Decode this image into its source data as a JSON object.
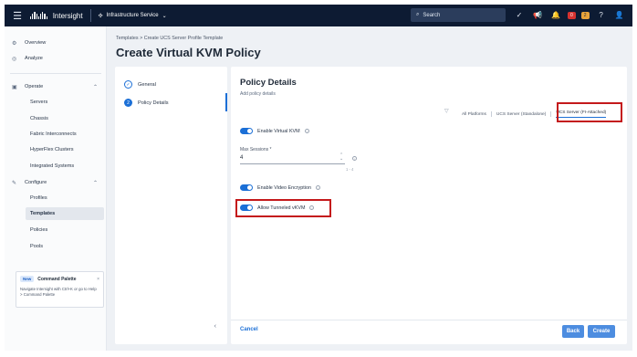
{
  "topbar": {
    "brand": "Intersight",
    "service": "Infrastructure Service",
    "search_placeholder": "Search",
    "badge_red": "0",
    "badge_orange": "2"
  },
  "sidebar": {
    "items": [
      {
        "label": "Overview",
        "icon": "gear-icon"
      },
      {
        "label": "Analyze",
        "icon": "target-icon"
      },
      {
        "label": "Operate",
        "icon": "operate-icon"
      },
      {
        "label": "Servers"
      },
      {
        "label": "Chassis"
      },
      {
        "label": "Fabric Interconnects"
      },
      {
        "label": "HyperFlex Clusters"
      },
      {
        "label": "Integrated Systems"
      },
      {
        "label": "Configure",
        "icon": "wrench-icon"
      },
      {
        "label": "Profiles"
      },
      {
        "label": "Templates"
      },
      {
        "label": "Policies"
      },
      {
        "label": "Pools"
      }
    ],
    "command_palette": {
      "tag": "New",
      "title": "Command Palette",
      "text": "Navigate Intersight with Ctrl+K or go to Help > Command Palette"
    }
  },
  "main": {
    "breadcrumb": "Templates  >  Create UCS Server Profile Template",
    "title": "Create Virtual KVM Policy",
    "steps": [
      {
        "label": "General",
        "marker": "✓"
      },
      {
        "label": "Policy Details",
        "marker": "2"
      }
    ],
    "panel": {
      "title": "Policy Details",
      "subtitle": "Add policy details",
      "platforms": [
        "All Platforms",
        "UCS Server (Standalone)",
        "UCS Server (FI-Attached)"
      ],
      "enable_vkvm": "Enable Virtual KVM",
      "max_sessions_label": "Max Sessions *",
      "max_sessions_value": "4",
      "max_sessions_range": "1 - 4",
      "enable_video_encryption": "Enable Video Encryption",
      "allow_tunneled_vkvm": "Allow Tunneled vKVM"
    },
    "footer": {
      "cancel": "Cancel",
      "back": "Back",
      "create": "Create"
    }
  }
}
